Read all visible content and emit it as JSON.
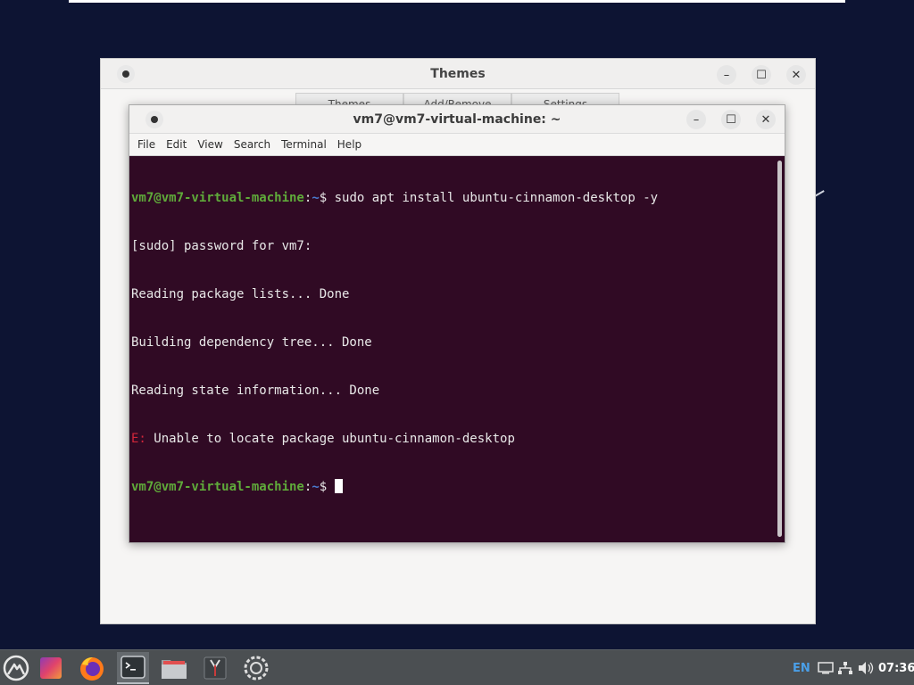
{
  "themes_window": {
    "title": "Themes",
    "tabs": [
      "Themes",
      "Add/Remove",
      "Settings"
    ]
  },
  "terminal": {
    "title": "vm7@vm7-virtual-machine: ~",
    "menu": [
      "File",
      "Edit",
      "View",
      "Search",
      "Terminal",
      "Help"
    ],
    "prompt_user": "vm7@vm7-virtual-machine",
    "prompt_sep": ":",
    "prompt_path": "~",
    "prompt_symbol": "$",
    "command": " sudo apt install ubuntu-cinnamon-desktop -y",
    "output": [
      "[sudo] password for vm7:",
      "Reading package lists... Done",
      "Building dependency tree... Done",
      "Reading state information... Done"
    ],
    "error_prefix": "E:",
    "error_message": " Unable to locate package ubuntu-cinnamon-desktop"
  },
  "taskbar": {
    "apps": [
      "menu-icon",
      "color-app-icon",
      "firefox-icon",
      "terminal-icon",
      "files-icon",
      "tweaks-icon",
      "settings-icon"
    ],
    "language": "EN",
    "clock": "07:36"
  },
  "colors": {
    "terminal_bg": "#300a24",
    "prompt_green": "#5faa3a",
    "prompt_blue": "#4a7bd0",
    "error_red": "#d2263a",
    "desktop_bg": "#0d1433",
    "taskbar_bg": "#4b4f52"
  }
}
